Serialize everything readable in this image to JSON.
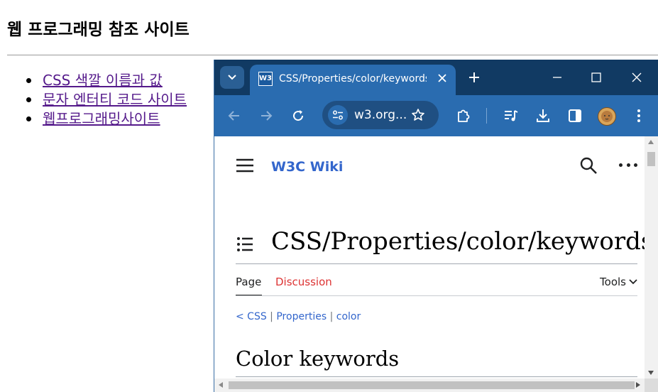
{
  "page": {
    "title": "웹 프로그래밍 참조 사이트",
    "links": [
      "CSS 색깔 이름과 값",
      "문자 엔터티 코드 사이트",
      "웹프로그래밍사이트"
    ]
  },
  "browser": {
    "tab": {
      "title": "CSS/Properties/color/keywords",
      "favicon_text": "W3"
    },
    "address_bar": {
      "url": "w3.org..."
    },
    "colors": {
      "titlebar": "#113a63",
      "toolbar": "#2a6cb0",
      "accent": "#3366cc"
    },
    "icons": [
      "tab-search-icon",
      "close-icon",
      "new-tab-icon",
      "minimize-icon",
      "maximize-icon",
      "back-icon",
      "forward-icon",
      "reload-icon",
      "site-info-icon",
      "star-icon",
      "extensions-icon",
      "media-controls-icon",
      "download-icon",
      "side-panel-icon",
      "profile-avatar",
      "menu-icon"
    ]
  },
  "wiki": {
    "logo": "W3C Wiki",
    "heading": "CSS/Properties/color/keywords",
    "tabs": {
      "page": "Page",
      "discussion": "Discussion",
      "tools": "Tools"
    },
    "breadcrumb": {
      "prefix": "< CSS",
      "sep1": " | ",
      "item2": "Properties",
      "sep2": " | ",
      "item3": "color"
    },
    "section_heading": "Color keywords"
  }
}
